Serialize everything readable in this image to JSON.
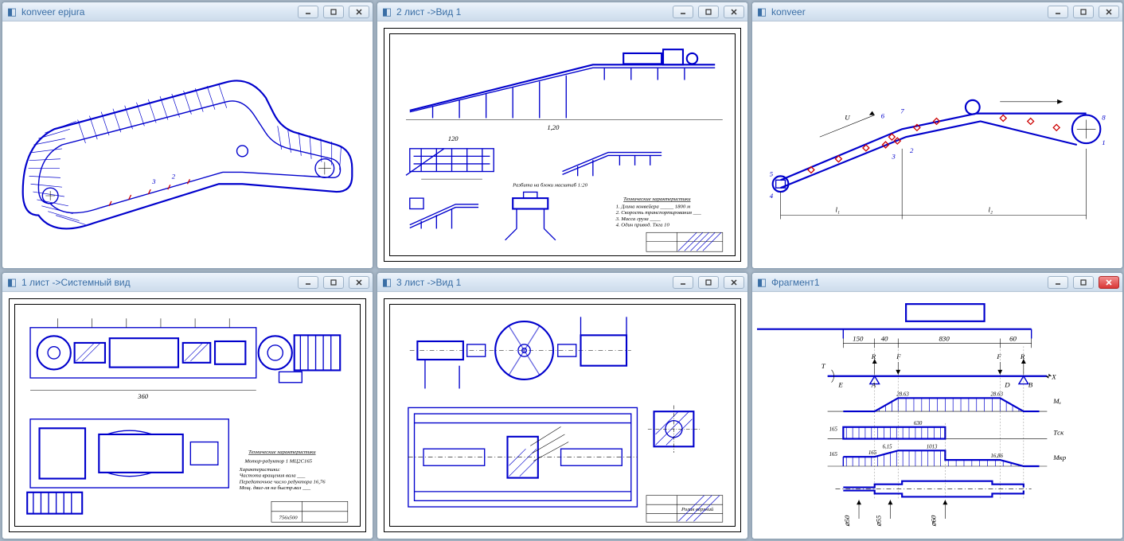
{
  "windows": [
    {
      "title": "konveer epjura",
      "close_style": "normal",
      "drawing": {
        "type": "epjura",
        "labels": [
          "3",
          "2"
        ]
      }
    },
    {
      "title": "2 лист ->Вид 1",
      "close_style": "normal",
      "drawing": {
        "type": "sheet2",
        "dim1": "120",
        "dim2": "1,20",
        "annot": "Разбита на блоки масштаб 1:20",
        "tech_header": "Технические характеристики",
        "notes": [
          "1. Длина конвейера _____ 1800 м",
          "2. Скорость транспортирования ___",
          "3. Масса груза ____",
          "4. Один привод. Тяга 10"
        ]
      }
    },
    {
      "title": "konveer",
      "close_style": "normal",
      "drawing": {
        "type": "scheme",
        "labels": [
          "1",
          "2",
          "3",
          "4",
          "5",
          "6",
          "7",
          "8"
        ],
        "dims": [
          "l₁",
          "l₂",
          "U"
        ]
      }
    },
    {
      "title": "1 лист ->Системный вид",
      "close_style": "normal",
      "drawing": {
        "type": "sheet1",
        "dim": "360",
        "reducer": "Мотор-редуктор 1 МЦ2С165",
        "tech_header": "Технические характеристики",
        "notes": [
          "Характеристики:",
          "Частота вращения вала ___",
          "Передаточное число редуктора 16,76",
          "Мощ. двиг-ля на быстр.вал ___"
        ],
        "size_label": "756x500"
      }
    },
    {
      "title": "3 лист ->Вид 1",
      "close_style": "normal",
      "drawing": {
        "type": "sheet3",
        "title_label": "Ролик верхний"
      }
    },
    {
      "title": "Фрагмент1",
      "close_style": "red",
      "drawing": {
        "type": "fragment",
        "top_dims": [
          "150",
          "40",
          "830",
          "60"
        ],
        "side_labels": [
          "T",
          "E",
          "A",
          "D",
          "B",
          "X"
        ],
        "moment_labels": [
          "Mₓ",
          "Tск",
          "Mкр"
        ],
        "values": [
          "165",
          "28.63",
          "630",
          "28.63",
          "16,86",
          "165",
          "165",
          "6,15",
          "1013",
          "16,86"
        ],
        "force_labels": [
          "R",
          "F",
          "F",
          "R"
        ],
        "diam": [
          "⌀50",
          "⌀55",
          "⌀60"
        ]
      }
    }
  ]
}
